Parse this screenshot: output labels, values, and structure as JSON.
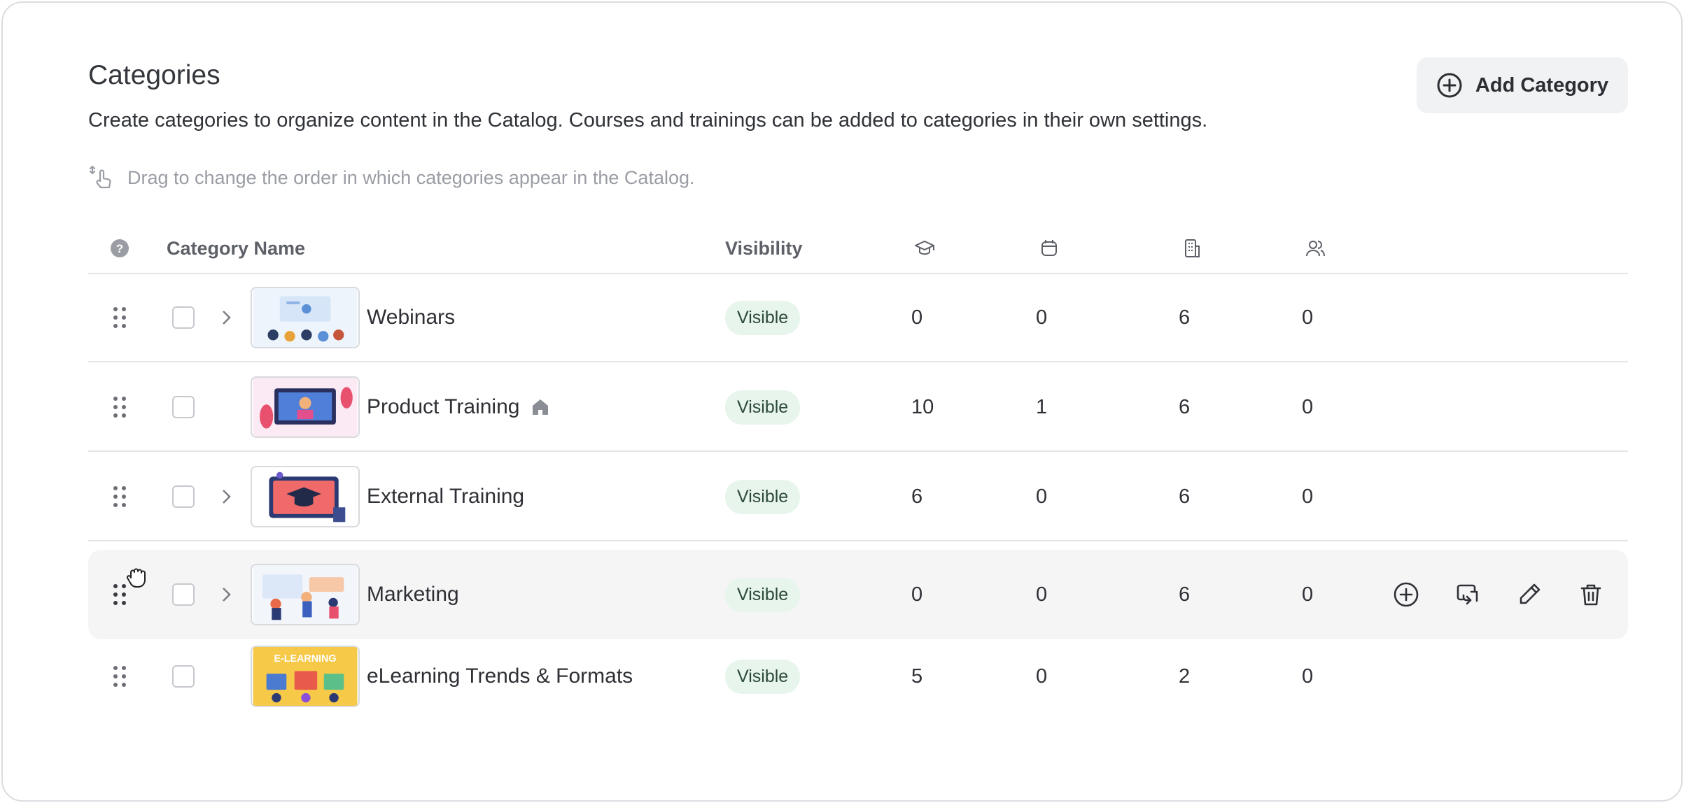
{
  "header": {
    "title": "Categories",
    "subtitle": "Create categories to organize content in the Catalog. Courses and trainings can be added to categories in their own settings.",
    "hint": "Drag to change the order in which categories appear in the Catalog.",
    "add_button": "Add Category"
  },
  "columns": {
    "name": "Category Name",
    "visibility": "Visibility",
    "icons": [
      "graduation-cap-icon",
      "calendar-icon",
      "building-icon",
      "users-icon"
    ]
  },
  "rows": [
    {
      "name": "Webinars",
      "visibility": "Visible",
      "courses": "0",
      "events": "0",
      "branches": "6",
      "users": "0",
      "expandable": true,
      "home": false,
      "thumb": "webinar-illustration"
    },
    {
      "name": "Product Training",
      "visibility": "Visible",
      "courses": "10",
      "events": "1",
      "branches": "6",
      "users": "0",
      "expandable": false,
      "home": true,
      "thumb": "product-illustration"
    },
    {
      "name": "External Training",
      "visibility": "Visible",
      "courses": "6",
      "events": "0",
      "branches": "6",
      "users": "0",
      "expandable": true,
      "home": false,
      "thumb": "graduation-illustration"
    },
    {
      "name": "Marketing",
      "visibility": "Visible",
      "courses": "0",
      "events": "0",
      "branches": "6",
      "users": "0",
      "expandable": true,
      "home": false,
      "thumb": "marketing-illustration"
    },
    {
      "name": "eLearning Trends & Formats",
      "visibility": "Visible",
      "courses": "5",
      "events": "0",
      "branches": "2",
      "users": "0",
      "expandable": false,
      "home": false,
      "thumb": "elearning-illustration",
      "thumb_text": "E-LEARNING"
    }
  ],
  "colors": {
    "badge_bg": "#e7f5ec",
    "hover_row": "#f5f5f6",
    "border": "#e4e5e8"
  }
}
